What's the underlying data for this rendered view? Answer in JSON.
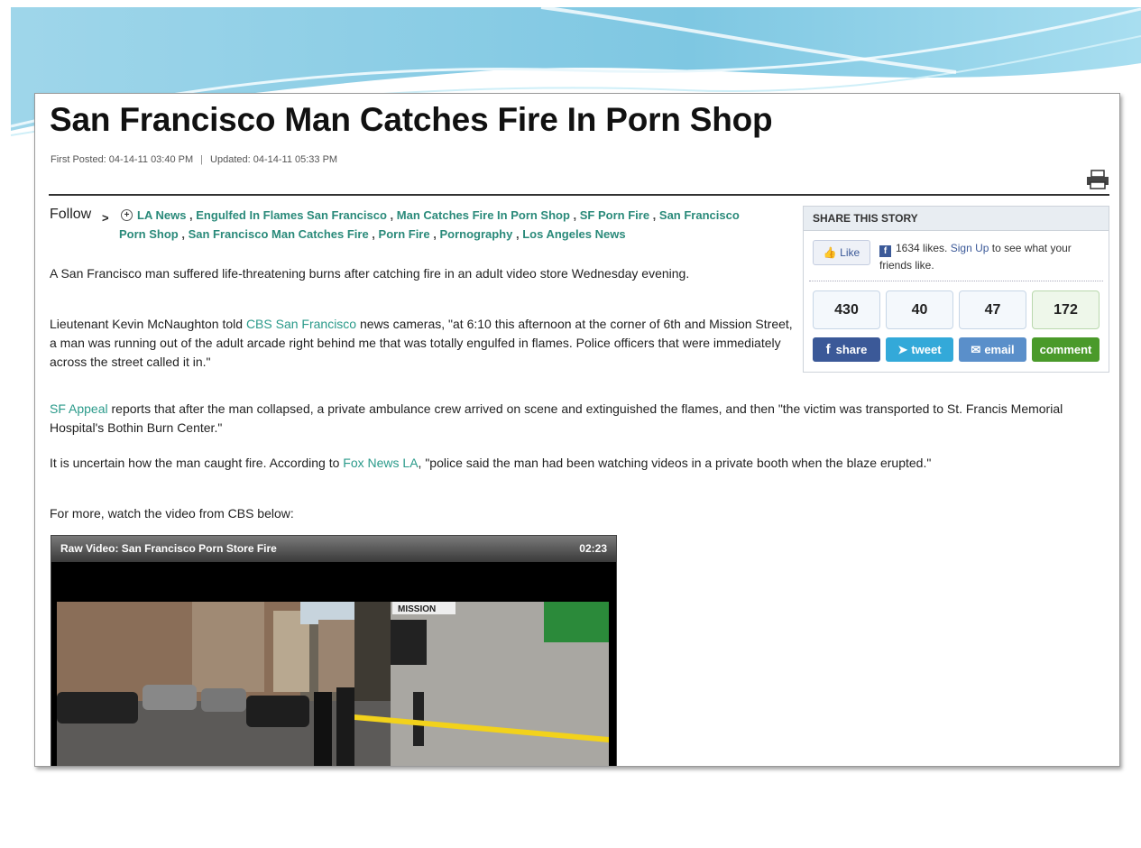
{
  "article": {
    "title": "San Francisco Man Catches Fire In Porn Shop",
    "first_posted": "First Posted: 04-14-11 03:40 PM",
    "separator": "|",
    "updated": "Updated: 04-14-11 05:33 PM"
  },
  "follow": {
    "label": "Follow",
    "arrow": ">",
    "tags": [
      "LA News",
      "Engulfed In Flames San Francisco",
      "Man Catches Fire In Porn Shop",
      "SF Porn Fire",
      "San Francisco Porn Shop",
      "San Francisco Man Catches Fire",
      "Porn Fire",
      "Pornography",
      "Los Angeles News"
    ]
  },
  "body": {
    "p1": "A San Francisco man suffered life-threatening burns after catching fire in an adult video store Wednesday evening.",
    "p2_before": "Lieutenant Kevin McNaughton told ",
    "p2_link": "CBS San Francisco",
    "p2_after": " news cameras, \"at 6:10 this afternoon at the corner of 6th and Mission Street, a man was running out of the adult arcade right behind me that was totally engulfed in flames. Police officers that were immediately across the street called it in.\"",
    "p3_link": "SF Appeal",
    "p3_after": " reports that after the man collapsed, a private ambulance crew arrived on scene and extinguished the flames, and then \"the victim was transported to St. Francis Memorial Hospital's Bothin Burn Center.\"",
    "p4_before": "It is uncertain how the man caught fire. According to ",
    "p4_link": "Fox News LA",
    "p4_after": ", \"police said the man had been watching videos in a private booth when the blaze erupted.\"",
    "p5": "For more, watch the video from CBS below:"
  },
  "share": {
    "heading": "SHARE THIS STORY",
    "like_label": "Like",
    "likes_text": "1634 likes.",
    "signup": "Sign Up",
    "likes_suffix": " to see what your friends like.",
    "counts": [
      "430",
      "40",
      "47",
      "172"
    ],
    "buttons": [
      "share",
      "tweet",
      "email",
      "comment"
    ]
  },
  "video": {
    "title": "Raw Video: San Francisco Porn Store Fire",
    "duration": "02:23",
    "sign_text": "MISSION"
  },
  "icons": [
    "printer-icon",
    "facebook-icon",
    "twitter-icon",
    "email-icon",
    "thumbs-up-icon",
    "plus-circle-icon"
  ],
  "colors": {
    "link": "#2a9a8a",
    "facebook": "#3b5998",
    "twitter": "#33a9d9",
    "email": "#5a8fca",
    "comment": "#4a9a2a"
  }
}
